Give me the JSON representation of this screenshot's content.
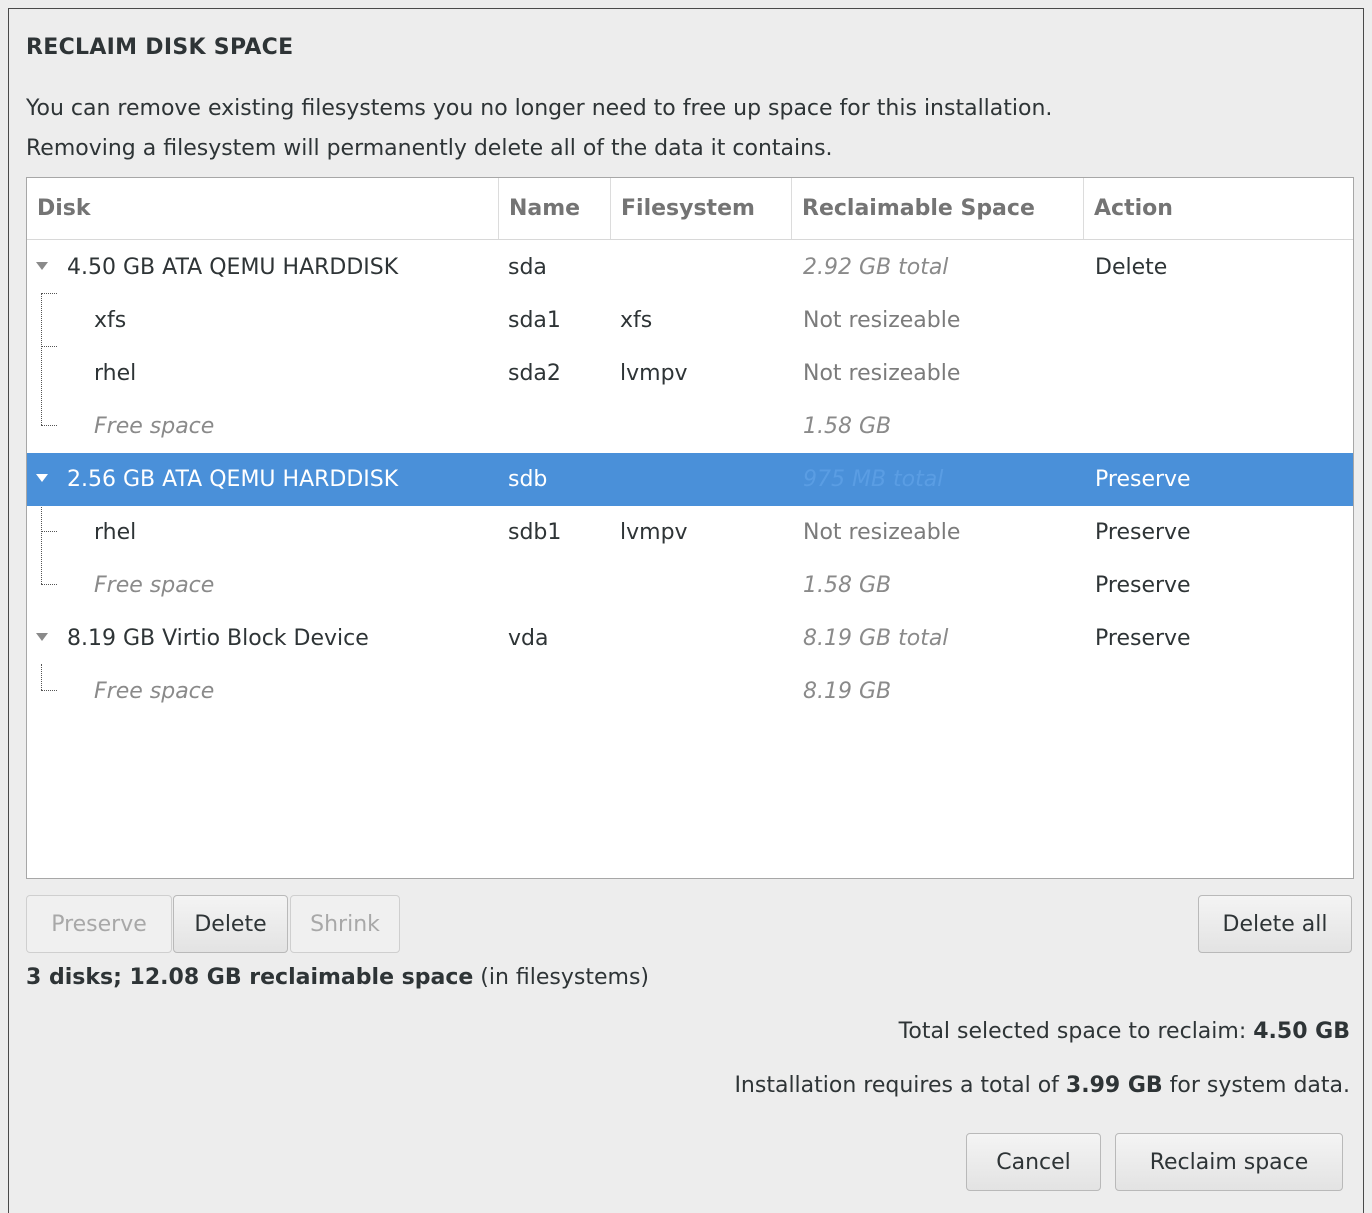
{
  "dialog": {
    "title": "RECLAIM DISK SPACE",
    "description_line1": "You can remove existing filesystems you no longer need to free up space for this installation.",
    "description_line2": "Removing a filesystem will permanently delete all of the data it contains."
  },
  "table": {
    "columns": [
      "Disk",
      "Name",
      "Filesystem",
      "Reclaimable Space",
      "Action"
    ],
    "rows": [
      {
        "disk": "4.50 GB ATA QEMU HARDDISK",
        "name": "sda",
        "filesystem": "",
        "space": "2.92 GB total",
        "action": "Delete"
      },
      {
        "disk": "xfs",
        "name": "sda1",
        "filesystem": "xfs",
        "space": "Not resizeable",
        "action": ""
      },
      {
        "disk": "rhel",
        "name": "sda2",
        "filesystem": "lvmpv",
        "space": "Not resizeable",
        "action": ""
      },
      {
        "disk": "Free space",
        "name": "",
        "filesystem": "",
        "space": "1.58 GB",
        "action": ""
      },
      {
        "disk": "2.56 GB ATA QEMU HARDDISK",
        "name": "sdb",
        "filesystem": "",
        "space": "975 MB total",
        "action": "Preserve"
      },
      {
        "disk": "rhel",
        "name": "sdb1",
        "filesystem": "lvmpv",
        "space": "Not resizeable",
        "action": "Preserve"
      },
      {
        "disk": "Free space",
        "name": "",
        "filesystem": "",
        "space": "1.58 GB",
        "action": "Preserve"
      },
      {
        "disk": "8.19 GB Virtio Block Device",
        "name": "vda",
        "filesystem": "",
        "space": "8.19 GB total",
        "action": "Preserve"
      },
      {
        "disk": "Free space",
        "name": "",
        "filesystem": "",
        "space": "8.19 GB",
        "action": ""
      }
    ]
  },
  "buttons": {
    "preserve": "Preserve",
    "delete": "Delete",
    "shrink": "Shrink",
    "delete_all": "Delete all",
    "cancel": "Cancel",
    "reclaim": "Reclaim space"
  },
  "summary": {
    "bold": "3 disks; 12.08 GB reclaimable space",
    "suffix": " (in filesystems)"
  },
  "totals": {
    "selected_label": "Total selected space to reclaim: ",
    "selected_value": "4.50 GB",
    "requires_prefix": "Installation requires a total of ",
    "requires_value": "3.99 GB",
    "requires_suffix": " for system data."
  }
}
